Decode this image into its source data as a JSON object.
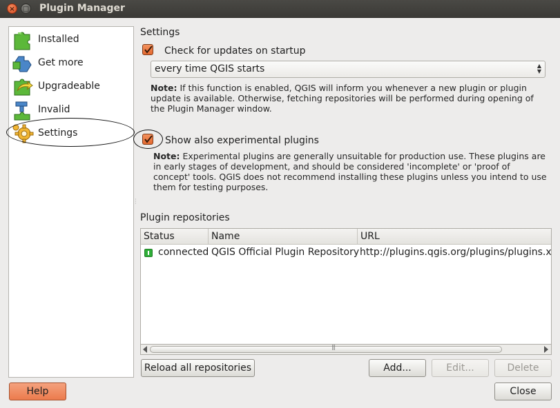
{
  "window": {
    "title": "Plugin Manager",
    "close_glyph": "×",
    "maximize_glyph": "□"
  },
  "sidebar": {
    "items": [
      {
        "label": "Installed",
        "icon": "puzzle-green-icon"
      },
      {
        "label": "Get more",
        "icon": "puzzle-blue-icon"
      },
      {
        "label": "Upgradeable",
        "icon": "puzzle-upgrade-icon"
      },
      {
        "label": "Invalid",
        "icon": "puzzle-invalid-icon"
      },
      {
        "label": "Settings",
        "icon": "gear-icon",
        "selected": true
      }
    ]
  },
  "settings": {
    "heading": "Settings",
    "check_updates": {
      "label": "Check for updates on startup",
      "checked": true
    },
    "frequency": {
      "value": "every time QGIS starts"
    },
    "note1_bold": "Note:",
    "note1_text": " If this function is enabled, QGIS will inform you whenever a new plugin or plugin update is available. Otherwise, fetching repositories will be performed during opening of the Plugin Manager window.",
    "experimental": {
      "label": "Show also experimental plugins",
      "checked": true
    },
    "note2_bold": "Note:",
    "note2_text": " Experimental plugins are generally unsuitable for production use. These plugins are in early stages of development, and should be considered 'incomplete' or 'proof of concept' tools. QGIS does not recommend installing these plugins unless you intend to use them for testing purposes."
  },
  "repositories": {
    "heading": "Plugin repositories",
    "columns": [
      "Status",
      "Name",
      "URL"
    ],
    "rows": [
      {
        "status": "connected",
        "name": "QGIS Official Plugin Repository",
        "url": "http://plugins.qgis.org/plugins/plugins.xml"
      }
    ],
    "scroll_grip": "|||"
  },
  "buttons": {
    "reload": "Reload all repositories",
    "add": "Add...",
    "edit": "Edit...",
    "delete": "Delete",
    "help": "Help",
    "close": "Close"
  },
  "colors": {
    "accent_orange": "#e4692f",
    "status_green": "#2fae38"
  }
}
